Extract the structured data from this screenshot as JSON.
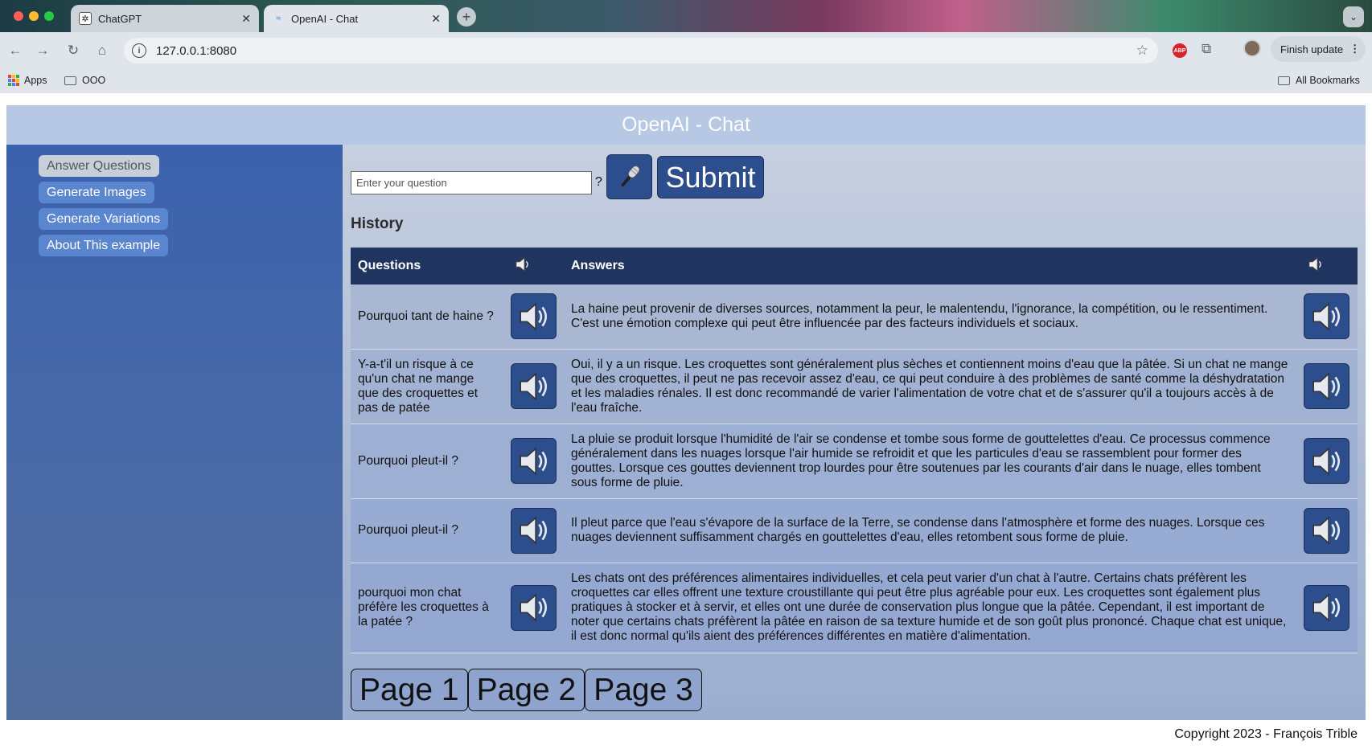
{
  "browser": {
    "tabs": [
      {
        "title": "ChatGPT",
        "icon": "chatgpt-icon"
      },
      {
        "title": "OpenAI - Chat",
        "icon": "wave-icon"
      }
    ],
    "url": "127.0.0.1:8080",
    "finish_update": "Finish update",
    "bookmarks": [
      "Apps",
      "OOO"
    ],
    "all_bookmarks": "All Bookmarks"
  },
  "app": {
    "title": "OpenAI - Chat",
    "sidebar": [
      "Answer Questions",
      "Generate Images",
      "Generate Variations",
      "About This example"
    ],
    "active_sidebar": "Answer Questions",
    "question_placeholder": "Enter your question",
    "question_mark": "?",
    "submit_label": "Submit",
    "history_title": "History",
    "table_headers": {
      "questions": "Questions",
      "answers": "Answers"
    },
    "rows": [
      {
        "q": "Pourquoi tant de haine ?",
        "a": "La haine peut provenir de diverses sources, notamment la peur, le malentendu, l'ignorance, la compétition, ou le ressentiment. C'est une émotion complexe qui peut être influencée par des facteurs individuels et sociaux."
      },
      {
        "q": "Y-a-t'il un risque à ce qu'un chat ne mange que des croquettes et pas de patée",
        "a": "Oui, il y a un risque. Les croquettes sont généralement plus sèches et contiennent moins d'eau que la pâtée. Si un chat ne mange que des croquettes, il peut ne pas recevoir assez d'eau, ce qui peut conduire à des problèmes de santé comme la déshydratation et les maladies rénales. Il est donc recommandé de varier l'alimentation de votre chat et de s'assurer qu'il a toujours accès à de l'eau fraîche."
      },
      {
        "q": "Pourquoi pleut-il ?",
        "a": "La pluie se produit lorsque l'humidité de l'air se condense et tombe sous forme de gouttelettes d'eau. Ce processus commence généralement dans les nuages lorsque l'air humide se refroidit et que les particules d'eau se rassemblent pour former des gouttes. Lorsque ces gouttes deviennent trop lourdes pour être soutenues par les courants d'air dans le nuage, elles tombent sous forme de pluie."
      },
      {
        "q": "Pourquoi pleut-il ?",
        "a": "Il pleut parce que l'eau s'évapore de la surface de la Terre, se condense dans l'atmosphère et forme des nuages. Lorsque ces nuages deviennent suffisamment chargés en gouttelettes d'eau, elles retombent sous forme de pluie."
      },
      {
        "q": "pourquoi mon chat préfère les croquettes à la patée ?",
        "a": "Les chats ont des préférences alimentaires individuelles, et cela peut varier d'un chat à l'autre. Certains chats préfèrent les croquettes car elles offrent une texture croustillante qui peut être plus agréable pour eux. Les croquettes sont également plus pratiques à stocker et à servir, et elles ont une durée de conservation plus longue que la pâtée. Cependant, il est important de noter que certains chats préfèrent la pâtée en raison de sa texture humide et de son goût plus prononcé. Chaque chat est unique, il est donc normal qu'ils aient des préférences différentes en matière d'alimentation."
      }
    ],
    "pages": [
      "Page 1",
      "Page 2",
      "Page 3"
    ],
    "copyright": "Copyright 2023 - François Trible"
  },
  "colors": {
    "header": "#b6c8e4",
    "sidebar": "#3b62ad",
    "button": "#2d4e8c",
    "table_header": "#1f3560"
  }
}
